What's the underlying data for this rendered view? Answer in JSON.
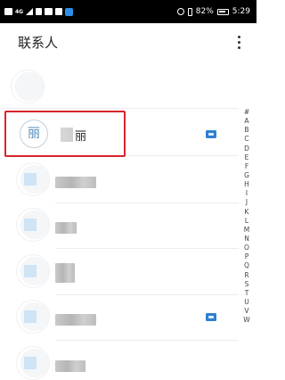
{
  "status_bar": {
    "network_label": "4G",
    "battery_percent": "82%",
    "time": "5:29",
    "icons": [
      "hd-icon",
      "signal-icon",
      "nfc-icon",
      "wechat-icon",
      "weibo-icon",
      "telegram-icon",
      "alarm-icon",
      "vibrate-icon",
      "battery-icon"
    ]
  },
  "header": {
    "title": "联系人",
    "menu_icon": "more-vert-icon"
  },
  "contacts": {
    "selected": {
      "avatar_char": "丽",
      "name_visible": "丽",
      "sim_icon": "sim-card-icon"
    }
  },
  "alpha_index": [
    "#",
    "A",
    "B",
    "C",
    "D",
    "E",
    "F",
    "G",
    "H",
    "I",
    "J",
    "K",
    "L",
    "M",
    "N",
    "O",
    "P",
    "Q",
    "R",
    "S",
    "T",
    "U",
    "V",
    "W"
  ],
  "colors": {
    "accent_blue": "#2e7fd1",
    "highlight_red": "#d6252c",
    "avatar_text": "#4f88b8"
  }
}
